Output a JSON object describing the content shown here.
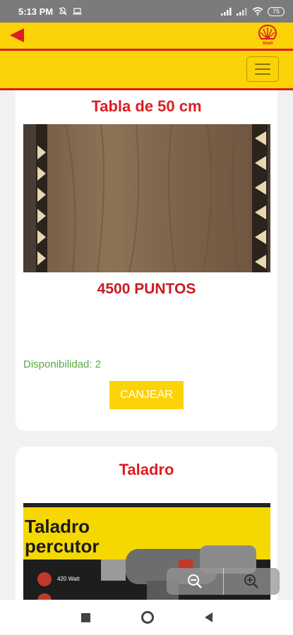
{
  "status_bar": {
    "time": "5:13 PM",
    "battery": "75",
    "icons": [
      "muted-bell-icon",
      "laptop-icon",
      "signal-icon",
      "signal-icon",
      "wifi-icon",
      "battery-icon"
    ]
  },
  "header": {
    "back_icon": "back-arrow-icon",
    "logo_text": "Shell",
    "menu_icon": "hamburger-menu-icon"
  },
  "products": [
    {
      "title": "Tabla de 50 cm",
      "points": "4500 PUNTOS",
      "availability": "Disponibilidad: 2",
      "button_label": "CANJEAR"
    },
    {
      "title": "Taladro",
      "image_text_line1": "Taladro",
      "image_text_line2": "percutor",
      "image_badge": "420 Watt"
    }
  ],
  "zoom": {
    "out_icon": "zoom-out-icon",
    "in_icon": "zoom-in-icon"
  },
  "colors": {
    "shell_yellow": "#fcd307",
    "shell_red": "#dd1d21",
    "availability_green": "#5aa844"
  }
}
